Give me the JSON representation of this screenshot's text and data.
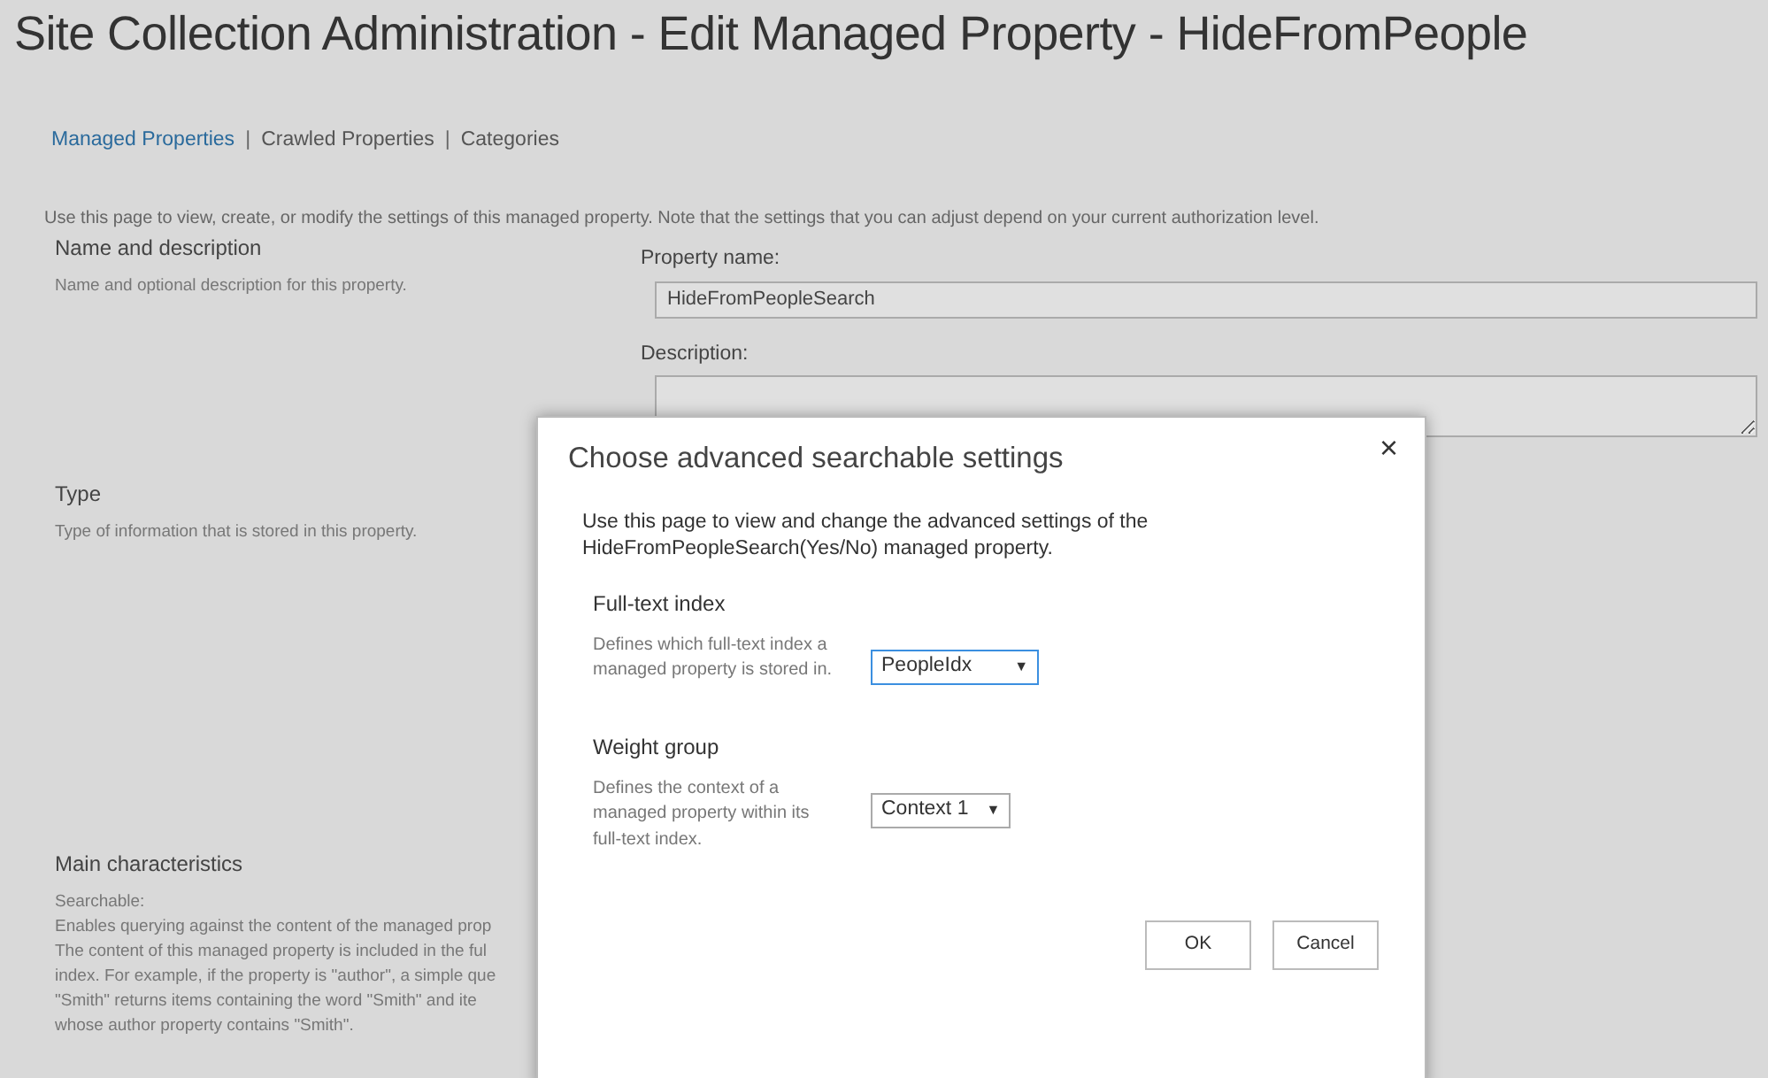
{
  "page_title": "Site Collection Administration - Edit Managed Property - HideFromPeople",
  "nav_links": [
    {
      "label": "Managed Properties",
      "selected": true
    },
    {
      "label": "Crawled Properties",
      "selected": false
    },
    {
      "label": "Categories",
      "selected": false
    }
  ],
  "nav_separators": [
    "|",
    "|"
  ],
  "intro": "Use this page to view, create, or modify the settings of this managed property. Note that the settings that you can adjust depend on your current authorization level.",
  "sections": [
    {
      "title": "Name and description",
      "description": [
        "Name and optional description for this property."
      ],
      "fields": [
        {
          "label": "Property name:",
          "kind": "text",
          "value": "HideFromPeopleSearch"
        },
        {
          "label": "Description:",
          "kind": "textarea"
        }
      ]
    },
    {
      "title": "Type",
      "description": [
        "Type of information that is stored in this property."
      ]
    },
    {
      "title": "Main characteristics",
      "description": [
        "Searchable:",
        "Enables querying against the content of the managed prop",
        "The content of this managed property is included in the ful",
        "index. For example, if the property is \"author\", a simple que",
        "\"Smith\" returns items containing the word \"Smith\" and ite",
        "whose author property contains \"Smith\"."
      ]
    }
  ],
  "dialog": {
    "title": "Choose advanced searchable settings",
    "close": "×",
    "intro": "Use this page to view and change the advanced settings of the HideFromPeopleSearch(Yes/No) managed property.",
    "groups": [
      {
        "title": "Full-text index",
        "description": "Defines which full-text index a managed property is stored in.",
        "value": "PeopleIdx",
        "caret": "▼",
        "focused": true
      },
      {
        "title": "Weight group",
        "description": "Defines the context of a managed property within its full-text index.",
        "value": "Context 1",
        "caret": "▼",
        "focused": false
      }
    ],
    "buttons": [
      "OK",
      "Cancel"
    ]
  }
}
